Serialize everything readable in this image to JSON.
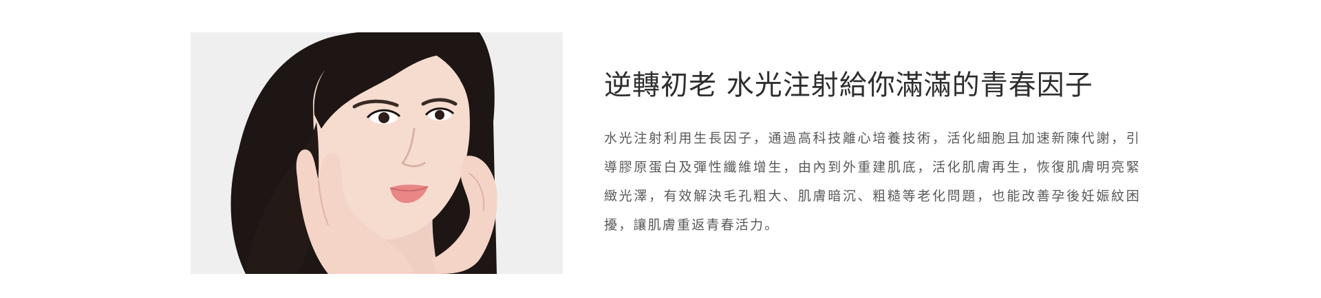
{
  "hero": {
    "image_alt": "水光注射",
    "headline": "逆轉初老 水光注射給你滿滿的青春因子",
    "paragraph": "水光注射利用生長因子，通過高科技離心培養技術，活化細胞且加速新陳代謝，引導膠原蛋白及彈性纖維增生，由內到外重建肌底，活化肌膚再生，恢復肌膚明亮緊緻光澤，有效解決毛孔粗大、肌膚暗沉、粗糙等老化問題，也能改善孕後妊娠紋困擾，讓肌膚重返青春活力。"
  },
  "colors": {
    "background": "#ffffff",
    "headline": "#2e2e2e",
    "body": "#595959",
    "photo_bg": "#efefef"
  }
}
